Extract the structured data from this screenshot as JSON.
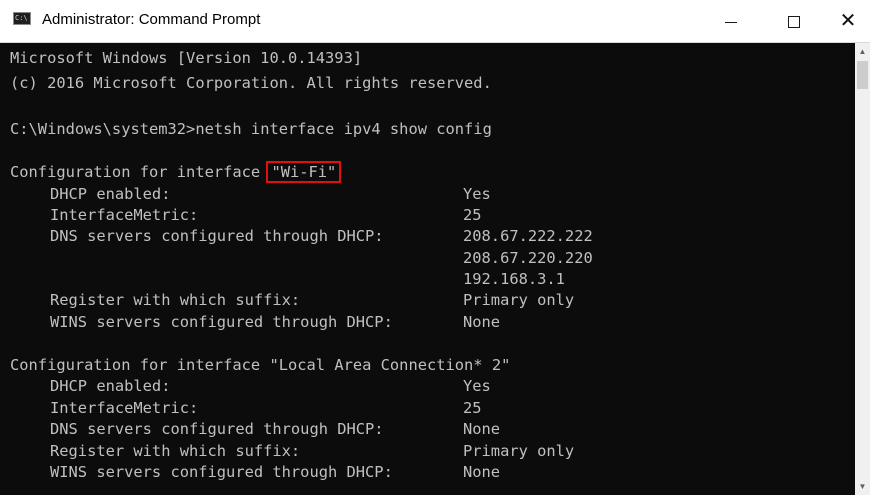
{
  "window": {
    "title": "Administrator: Command Prompt",
    "icon": "cmd-console-icon",
    "icon_text": "C:\\",
    "controls": {
      "minimize": "minimize-icon",
      "maximize": "maximize-icon",
      "close": "close-icon",
      "close_glyph": "✕"
    }
  },
  "colors": {
    "console_background": "#0c0c0c",
    "console_text": "#c0c0c0",
    "highlight_border": "#e01010"
  },
  "console": {
    "header": [
      "Microsoft Windows [Version 10.0.14393]",
      "(c) 2016 Microsoft Corporation. All rights reserved."
    ],
    "prompt": "C:\\Windows\\system32>",
    "command": "netsh interface ipv4 show config",
    "interfaces": [
      {
        "heading_prefix": "Configuration for interface ",
        "name": "\"Wi-Fi\"",
        "name_highlighted": true,
        "rows": [
          {
            "label": "DHCP enabled:",
            "value": "Yes"
          },
          {
            "label": "InterfaceMetric:",
            "value": "25"
          },
          {
            "label": "DNS servers configured through DHCP:",
            "value": "208.67.222.222"
          },
          {
            "label": "",
            "value": "208.67.220.220"
          },
          {
            "label": "",
            "value": "192.168.3.1"
          },
          {
            "label": "Register with which suffix:",
            "value": "Primary only"
          },
          {
            "label": "WINS servers configured through DHCP:",
            "value": "None"
          }
        ]
      },
      {
        "heading_prefix": "Configuration for interface ",
        "name": "\"Local Area Connection* 2\"",
        "name_highlighted": false,
        "rows": [
          {
            "label": "DHCP enabled:",
            "value": "Yes"
          },
          {
            "label": "InterfaceMetric:",
            "value": "25"
          },
          {
            "label": "DNS servers configured through DHCP:",
            "value": "None"
          },
          {
            "label": "Register with which suffix:",
            "value": "Primary only"
          },
          {
            "label": "WINS servers configured through DHCP:",
            "value": "None"
          }
        ]
      }
    ]
  },
  "scrollbar": {
    "up_arrow": "▲",
    "down_arrow": "▼"
  }
}
